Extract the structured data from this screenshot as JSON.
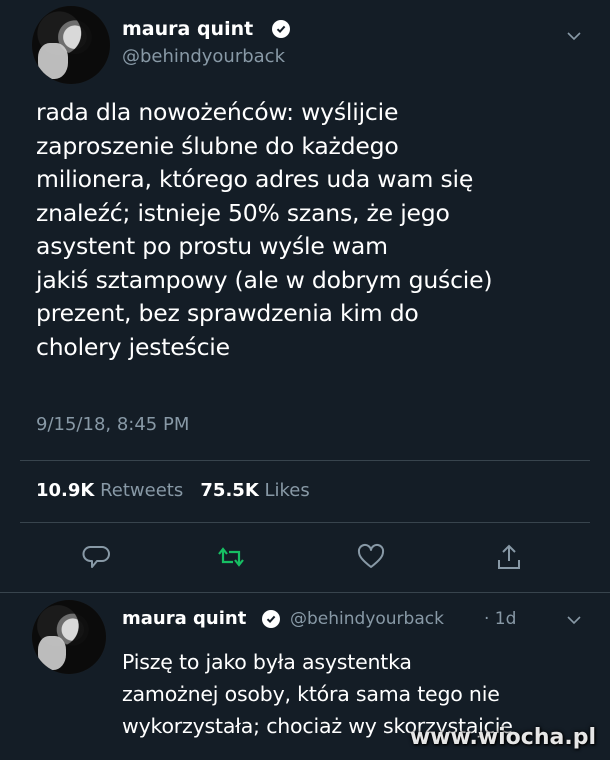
{
  "main_tweet": {
    "author_name": "maura quint",
    "author_handle": "@behindyourback",
    "text_lines": [
      "rada dla nowożeńców: wyślijcie",
      "zaproszenie ślubne do każdego",
      "milionera, którego adres uda wam się",
      "znaleźć; istnieje 50% szans, że jego",
      "asystent po prostu wyśle wam",
      "jakiś sztampowy (ale w dobrym guście)",
      "prezent, bez sprawdzenia kim do",
      "cholery jesteście"
    ],
    "timestamp": "9/15/18, 8:45 PM",
    "retweets_count": "10.9K",
    "retweets_label": "Retweets",
    "likes_count": "75.5K",
    "likes_label": "Likes"
  },
  "reply_tweet": {
    "author_name": "maura quint",
    "author_handle": "@behindyourback",
    "time_ago": "· 1d",
    "text_lines": [
      "Piszę to jako była asystentka",
      "zamożnej osoby, która sama tego nie",
      "wykorzystała; chociaż wy skorzystajcie"
    ]
  },
  "watermark": "www.wiocha.pl",
  "icons": {
    "verified": "verified-badge-icon",
    "chevron": "chevron-down-icon",
    "reply": "reply-icon",
    "retweet": "retweet-icon",
    "like": "like-icon",
    "share": "share-icon"
  },
  "colors": {
    "background": "#141d26",
    "muted_text": "#8899a6",
    "retweet_active": "#17bf63",
    "divider": "#38444d"
  }
}
